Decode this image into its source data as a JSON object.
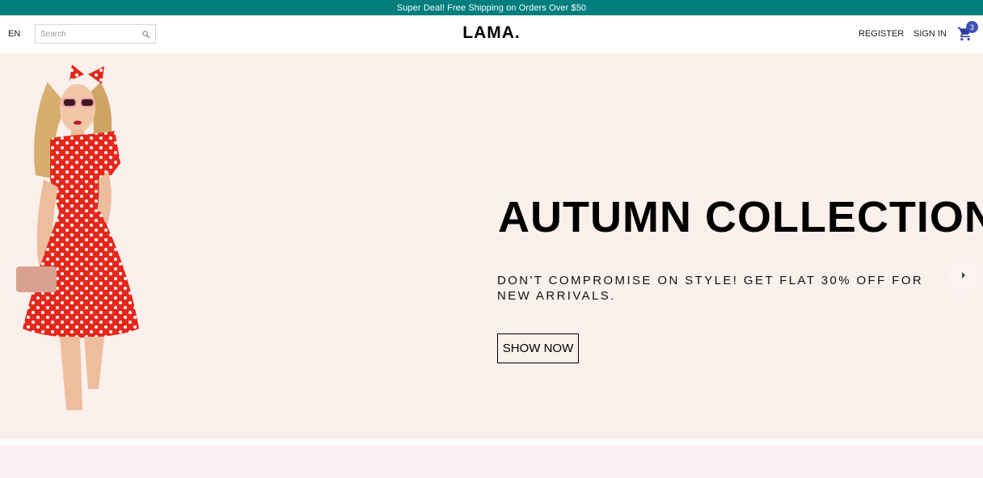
{
  "announcement": {
    "text": "Super Deal! Free Shipping on Orders Over $50"
  },
  "navbar": {
    "language": "EN",
    "search": {
      "placeholder": "Search",
      "value": ""
    },
    "logo": "LAMA.",
    "menu": {
      "register": "REGISTER",
      "sign_in": "SIGN IN"
    },
    "cart": {
      "count": "3",
      "icon": "shopping-cart-icon"
    }
  },
  "hero": {
    "title": "AUTUMN COLLECTION",
    "description": "DON'T COMPROMISE ON STYLE! GET FLAT 30% OFF FOR NEW ARRIVALS.",
    "button_label": "SHOW NOW",
    "background": "#fbf0ec"
  },
  "colors": {
    "announcement_bg": "#007d7d",
    "badge": "#3f51b5",
    "next_section_bg": "#f9eff2"
  }
}
